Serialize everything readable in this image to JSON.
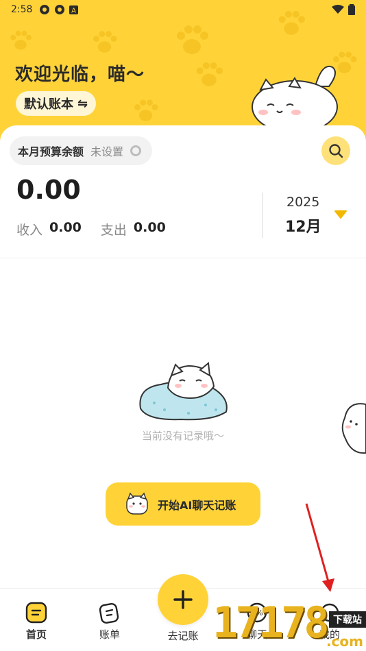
{
  "status_bar": {
    "time": "2:58"
  },
  "header": {
    "welcome": "欢迎光临，喵～",
    "book_label": "默认账本",
    "switch_glyph": "⇋"
  },
  "summary": {
    "budget_label": "本月预算余额",
    "budget_status": "未设置",
    "balance": "0.00",
    "income_label": "收入",
    "income_value": "0.00",
    "expense_label": "支出",
    "expense_value": "0.00",
    "year": "2025",
    "month": "12月"
  },
  "empty_state": {
    "text": "当前没有记录哦～",
    "ai_button": "开始AI聊天记账"
  },
  "tabbar": {
    "home": "首页",
    "bills": "账单",
    "add": "去记账",
    "chat": "聊天",
    "me": "我的"
  },
  "watermark": {
    "digits": "17178",
    "tag": "下载站",
    "com": ".com"
  },
  "colors": {
    "brand_yellow": "#ffd338",
    "annotation_red": "#e02020"
  },
  "icons": [
    "paw-icon",
    "search-icon",
    "triangle-down-icon",
    "plus-icon",
    "home-icon",
    "bill-icon",
    "chat-icon",
    "profile-icon",
    "cat-avatar-icon",
    "wifi-icon",
    "battery-icon"
  ]
}
